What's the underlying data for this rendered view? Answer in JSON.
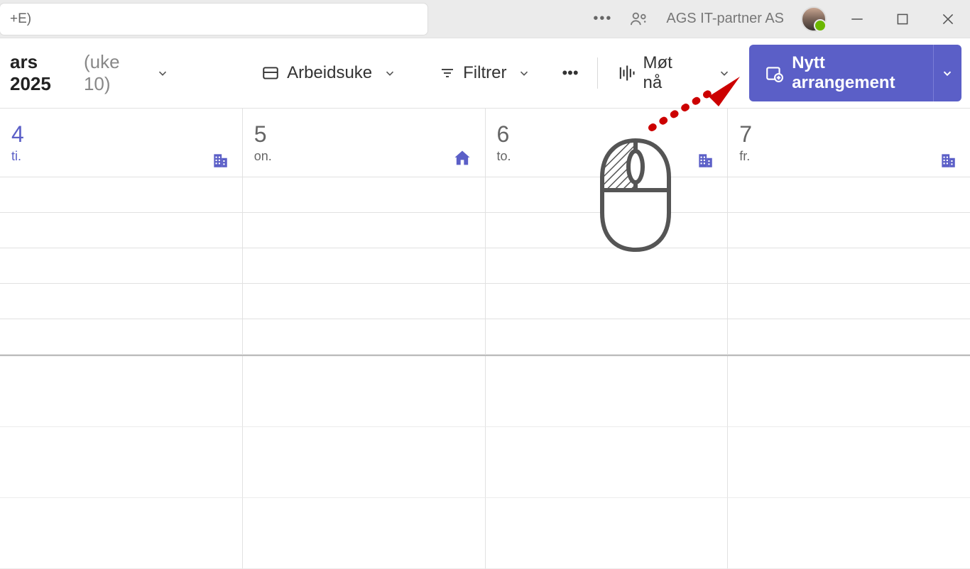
{
  "titlebar": {
    "search_placeholder": "+E)",
    "org_name": "AGS IT-partner AS"
  },
  "toolbar": {
    "month": "ars 2025",
    "week": "(uke 10)",
    "view_label": "Arbeidsuke",
    "filter_label": "Filtrer",
    "meet_now_label": "Møt nå",
    "new_event_label": "Nytt arrangement"
  },
  "days": [
    {
      "num": "4",
      "name": "ti.",
      "location": "office"
    },
    {
      "num": "5",
      "name": "on.",
      "location": "home"
    },
    {
      "num": "6",
      "name": "to.",
      "location": "office"
    },
    {
      "num": "7",
      "name": "fr.",
      "location": "office"
    }
  ]
}
